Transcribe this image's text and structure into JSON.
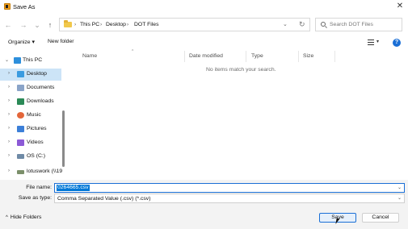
{
  "window": {
    "title": "Save As",
    "close_glyph": "✕"
  },
  "nav": {
    "back": "←",
    "forward": "→",
    "recent": "⌄",
    "up": "↑",
    "breadcrumb": [
      "This PC",
      "Desktop",
      "DOT Files"
    ],
    "separator": "›",
    "address_dropdown": "⌄",
    "refresh": "↻",
    "search_placeholder": "Search DOT Files"
  },
  "toolbar": {
    "organize": "Organize ▾",
    "new_folder": "New folder",
    "view_caret": "▾",
    "help": "?"
  },
  "sidebar": {
    "items": [
      {
        "label": "This PC",
        "icon": "pc-icon",
        "color": "#2d8fdc",
        "expanded": true
      },
      {
        "label": "Desktop",
        "icon": "desktop-icon",
        "color": "#3a9be0",
        "selected": true
      },
      {
        "label": "Documents",
        "icon": "documents-icon",
        "color": "#8aa4c8"
      },
      {
        "label": "Downloads",
        "icon": "downloads-icon",
        "color": "#2b8a57"
      },
      {
        "label": "Music",
        "icon": "music-icon",
        "color": "#e3663a"
      },
      {
        "label": "Pictures",
        "icon": "pictures-icon",
        "color": "#3c7fd8"
      },
      {
        "label": "Videos",
        "icon": "videos-icon",
        "color": "#8c5ad6"
      },
      {
        "label": "OS (C:)",
        "icon": "drive-icon",
        "color": "#6f8aa6"
      },
      {
        "label": "lotuswork (\\\\19",
        "icon": "network-drive-icon",
        "color": "#7b8f6a"
      }
    ]
  },
  "columns": [
    "Name",
    "Date modified",
    "Type",
    "Size"
  ],
  "empty_message": "No items match your search.",
  "bottom": {
    "file_name_label": "File name:",
    "file_name_value": "0264665.csv",
    "save_as_type_label": "Save as type:",
    "save_as_type_value": "Comma Separated Value (.csv) (*.csv)",
    "hide_folders": "Hide Folders",
    "save": "Save",
    "cancel": "Cancel"
  },
  "colors": {
    "accent": "#0078d7",
    "selected_bg": "#cce4f7",
    "footer_bg": "#f3f3f3"
  }
}
